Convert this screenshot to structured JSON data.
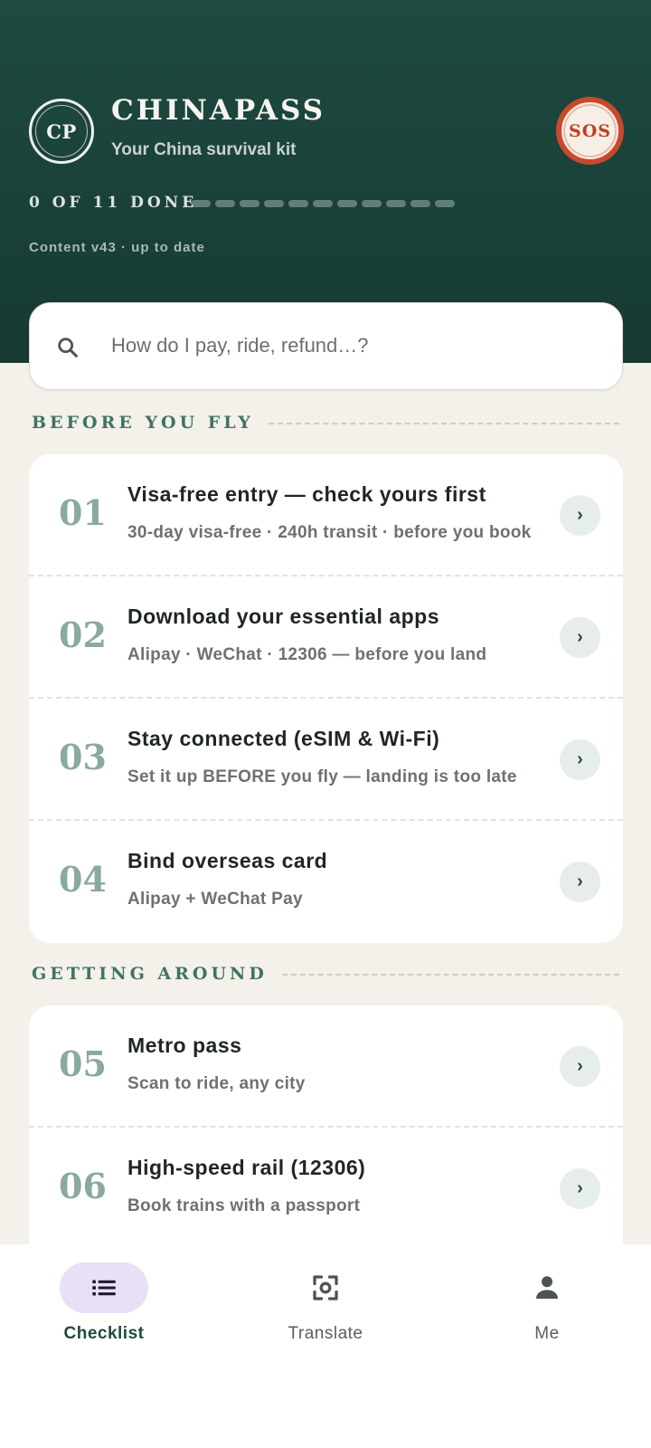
{
  "header": {
    "logo_text": "CP",
    "app_title": "CHINAPASS",
    "app_subtitle": "Your China survival kit",
    "sos_label": "SOS",
    "progress_label": "0 OF 11 DONE",
    "progress": {
      "done": 0,
      "total": 11
    },
    "content_version": "Content v43 · up to date"
  },
  "search": {
    "placeholder": "How do I pay, ride, refund…?",
    "icon": "search-icon"
  },
  "sections": [
    {
      "title": "BEFORE YOU FLY",
      "items": [
        {
          "num": "01",
          "title": "Visa-free entry — check yours first",
          "subtitle": "30-day visa-free · 240h transit · before you book",
          "chevron": "›"
        },
        {
          "num": "02",
          "title": "Download your essential apps",
          "subtitle": "Alipay · WeChat · 12306 — before you land",
          "chevron": "›"
        },
        {
          "num": "03",
          "title": "Stay connected (eSIM & Wi-Fi)",
          "subtitle": "Set it up BEFORE you fly — landing is too late",
          "chevron": "›"
        },
        {
          "num": "04",
          "title": "Bind overseas card",
          "subtitle": "Alipay + WeChat Pay",
          "chevron": "›"
        }
      ]
    },
    {
      "title": "GETTING AROUND",
      "items": [
        {
          "num": "05",
          "title": "Metro pass",
          "subtitle": "Scan to ride, any city",
          "chevron": "›"
        },
        {
          "num": "06",
          "title": "High-speed rail (12306)",
          "subtitle": "Book trains with a passport",
          "chevron": "›"
        }
      ]
    }
  ],
  "nav": [
    {
      "label": "Checklist",
      "icon": "list-icon",
      "active": true
    },
    {
      "label": "Translate",
      "icon": "scan-icon",
      "active": false
    },
    {
      "label": "Me",
      "icon": "person-icon",
      "active": false
    }
  ],
  "colors": {
    "header_bg": "#1e4a41",
    "accent_green": "#3f7366",
    "sos_red": "#c8492e",
    "page_bg": "#f4f1ea",
    "nav_active_pill": "#e9dff7"
  }
}
